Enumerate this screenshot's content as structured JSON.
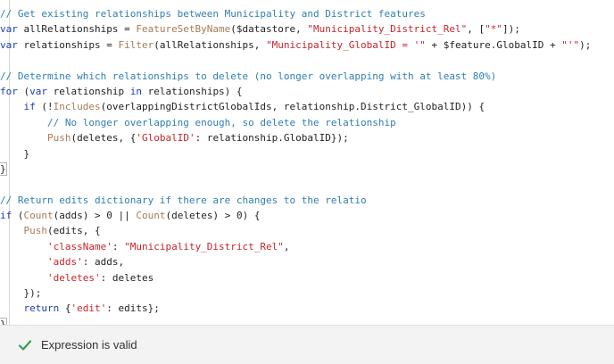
{
  "editor": {
    "lines": [
      [
        {
          "t": "// Get existing relationships between Municipality and District features",
          "c": "comment"
        }
      ],
      [
        {
          "t": "var",
          "c": "keyword"
        },
        {
          "t": " allRelationships = ",
          "c": "plain"
        },
        {
          "t": "FeatureSetByName",
          "c": "func"
        },
        {
          "t": "($datastore, ",
          "c": "plain"
        },
        {
          "t": "\"Municipality_District_Rel\"",
          "c": "string"
        },
        {
          "t": ", [",
          "c": "plain"
        },
        {
          "t": "\"*\"",
          "c": "string"
        },
        {
          "t": "]);",
          "c": "plain"
        }
      ],
      [
        {
          "t": "var",
          "c": "keyword"
        },
        {
          "t": " relationships = ",
          "c": "plain"
        },
        {
          "t": "Filter",
          "c": "func"
        },
        {
          "t": "(allRelationships, ",
          "c": "plain"
        },
        {
          "t": "\"Municipality_GlobalID = '\"",
          "c": "string"
        },
        {
          "t": " + $feature.GlobalID + ",
          "c": "plain"
        },
        {
          "t": "\"'\"",
          "c": "string"
        },
        {
          "t": ");",
          "c": "plain"
        }
      ],
      [],
      [
        {
          "t": "// Determine which relationships to delete (no longer overlapping with at least 80%)",
          "c": "comment"
        }
      ],
      [
        {
          "t": "for",
          "c": "keyword"
        },
        {
          "t": " (",
          "c": "plain"
        },
        {
          "t": "var",
          "c": "keyword"
        },
        {
          "t": " relationship ",
          "c": "plain"
        },
        {
          "t": "in",
          "c": "keyword"
        },
        {
          "t": " relationships) {",
          "c": "plain"
        }
      ],
      [
        {
          "t": "    ",
          "c": "plain"
        },
        {
          "t": "if",
          "c": "keyword"
        },
        {
          "t": " (!",
          "c": "plain"
        },
        {
          "t": "Includes",
          "c": "func"
        },
        {
          "t": "(overlappingDistrictGlobalIds, relationship.District_GlobalID)) {",
          "c": "plain"
        }
      ],
      [
        {
          "t": "        ",
          "c": "plain"
        },
        {
          "t": "// No longer overlapping enough, so delete the relationship",
          "c": "comment"
        }
      ],
      [
        {
          "t": "        ",
          "c": "plain"
        },
        {
          "t": "Push",
          "c": "func"
        },
        {
          "t": "(deletes, {",
          "c": "plain"
        },
        {
          "t": "'GlobalID'",
          "c": "string"
        },
        {
          "t": ": relationship.GlobalID});",
          "c": "plain"
        }
      ],
      [
        {
          "t": "    }",
          "c": "plain"
        }
      ],
      [
        {
          "t": "}",
          "c": "plain",
          "mark": true
        }
      ],
      [],
      [
        {
          "t": "// Return edits dictionary if there are changes to the relatio",
          "c": "comment"
        }
      ],
      [
        {
          "t": "if",
          "c": "keyword"
        },
        {
          "t": " (",
          "c": "plain"
        },
        {
          "t": "Count",
          "c": "func"
        },
        {
          "t": "(adds) > ",
          "c": "plain"
        },
        {
          "t": "0",
          "c": "number"
        },
        {
          "t": " || ",
          "c": "plain"
        },
        {
          "t": "Count",
          "c": "func"
        },
        {
          "t": "(deletes) > ",
          "c": "plain"
        },
        {
          "t": "0",
          "c": "number"
        },
        {
          "t": ") {",
          "c": "plain"
        }
      ],
      [
        {
          "t": "    ",
          "c": "plain"
        },
        {
          "t": "Push",
          "c": "func"
        },
        {
          "t": "(edits, {",
          "c": "plain"
        }
      ],
      [
        {
          "t": "        ",
          "c": "plain"
        },
        {
          "t": "'className'",
          "c": "string"
        },
        {
          "t": ": ",
          "c": "plain"
        },
        {
          "t": "\"Municipality_District_Rel\"",
          "c": "string"
        },
        {
          "t": ",",
          "c": "plain"
        }
      ],
      [
        {
          "t": "        ",
          "c": "plain"
        },
        {
          "t": "'adds'",
          "c": "string"
        },
        {
          "t": ": adds,",
          "c": "plain"
        }
      ],
      [
        {
          "t": "        ",
          "c": "plain"
        },
        {
          "t": "'deletes'",
          "c": "string"
        },
        {
          "t": ": deletes",
          "c": "plain"
        }
      ],
      [
        {
          "t": "    });",
          "c": "plain"
        }
      ],
      [
        {
          "t": "    ",
          "c": "plain"
        },
        {
          "t": "return",
          "c": "keyword"
        },
        {
          "t": " {",
          "c": "plain"
        },
        {
          "t": "'edit'",
          "c": "string"
        },
        {
          "t": ": edits};",
          "c": "plain"
        }
      ],
      [
        {
          "t": "}",
          "c": "plain",
          "mark": true
        }
      ]
    ],
    "colors": {
      "comment": "#2f7fb0",
      "keyword": "#1b3fb8",
      "function": "#a77a56",
      "string": "#c7252a",
      "plain": "#1f1f1f"
    }
  },
  "status": {
    "icon": "checkmark-icon",
    "icon_color": "#35a14a",
    "text": "Expression is valid"
  }
}
